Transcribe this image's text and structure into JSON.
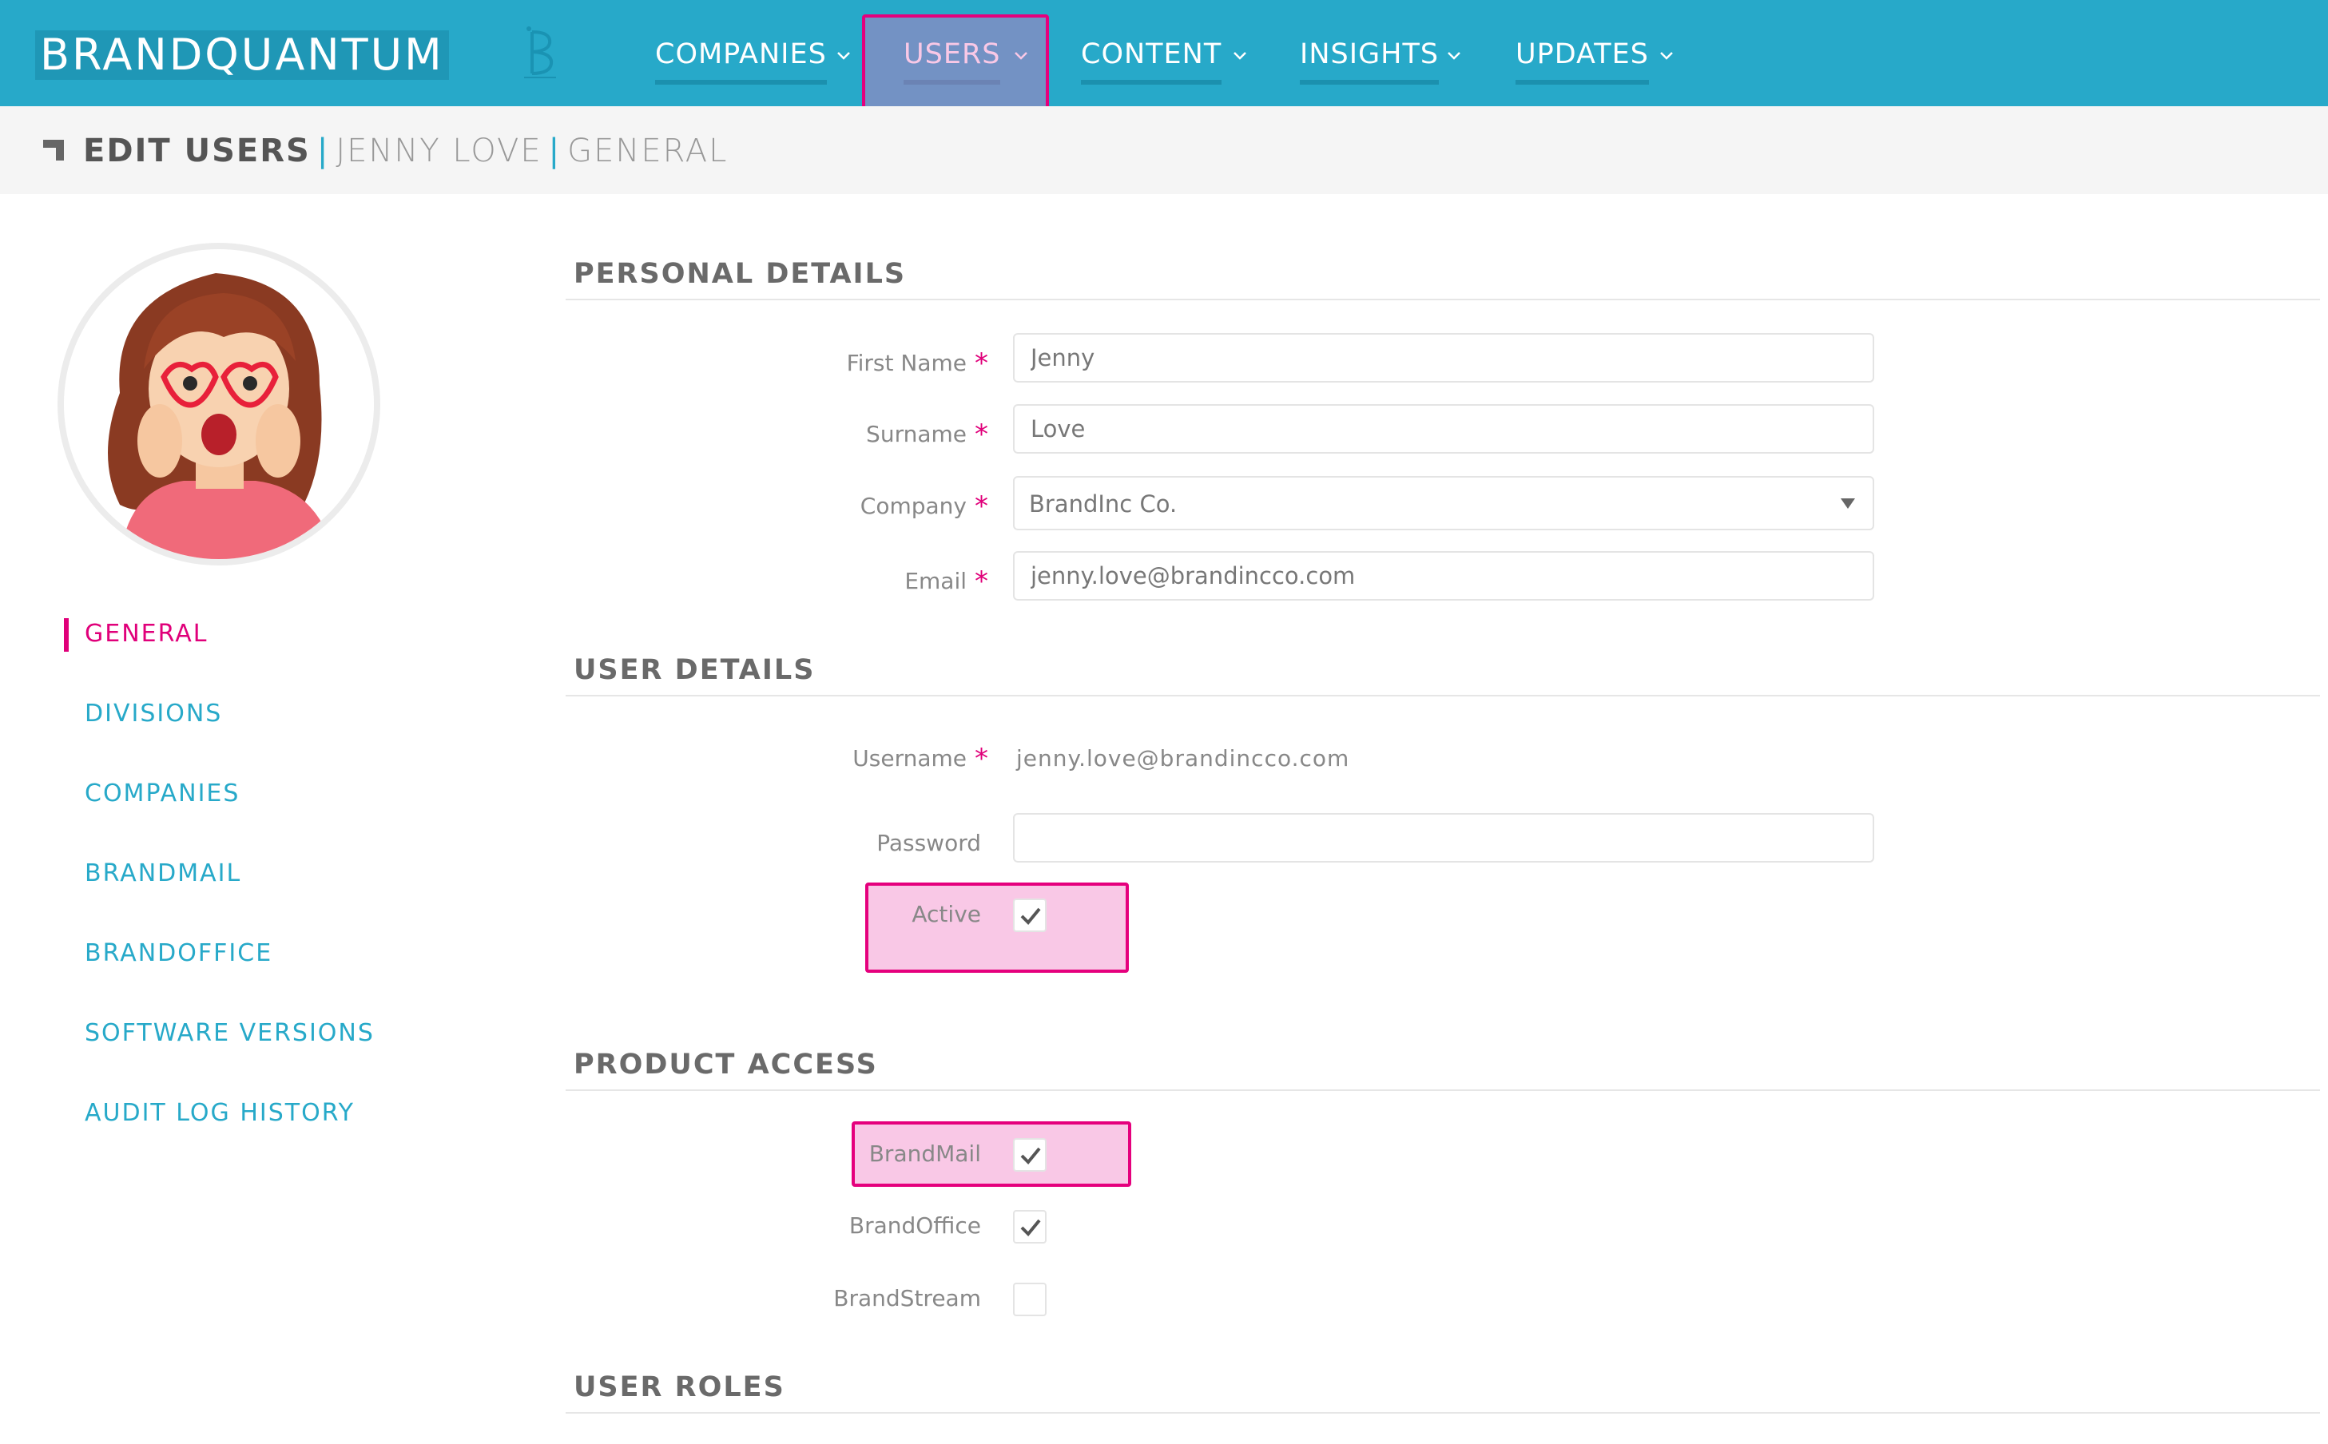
{
  "app": {
    "logo_text": "BRANDQUANTUM"
  },
  "nav": {
    "items": [
      {
        "label": "COMPANIES"
      },
      {
        "label": "USERS"
      },
      {
        "label": "CONTENT"
      },
      {
        "label": "INSIGHTS"
      },
      {
        "label": "UPDATES"
      }
    ],
    "active": "USERS"
  },
  "breadcrumb": {
    "section": "EDIT USERS",
    "user": "JENNY LOVE",
    "page": "GENERAL",
    "separator": "|"
  },
  "sidebar": {
    "items": [
      {
        "label": "GENERAL",
        "active": true
      },
      {
        "label": "DIVISIONS"
      },
      {
        "label": "COMPANIES"
      },
      {
        "label": "BRANDMAIL"
      },
      {
        "label": "BRANDOFFICE"
      },
      {
        "label": "SOFTWARE VERSIONS"
      },
      {
        "label": "AUDIT LOG HISTORY"
      }
    ]
  },
  "personal_details": {
    "title": "PERSONAL DETAILS",
    "first_name": {
      "label": "First Name",
      "value": "Jenny",
      "required": "*"
    },
    "surname": {
      "label": "Surname",
      "value": "Love",
      "required": "*"
    },
    "company": {
      "label": "Company",
      "value": "BrandInc Co.",
      "required": "*"
    },
    "email": {
      "label": "Email",
      "value": "jenny.love@brandincco.com",
      "required": "*"
    }
  },
  "user_details": {
    "title": "USER DETAILS",
    "username": {
      "label": "Username",
      "value": "jenny.love@brandincco.com",
      "required": "*"
    },
    "password": {
      "label": "Password",
      "value": ""
    },
    "active": {
      "label": "Active",
      "checked": true
    }
  },
  "product_access": {
    "title": "PRODUCT ACCESS",
    "products": [
      {
        "label": "BrandMail",
        "checked": true
      },
      {
        "label": "BrandOffice",
        "checked": true
      },
      {
        "label": "BrandStream",
        "checked": false
      }
    ]
  },
  "user_roles": {
    "title": "USER ROLES"
  },
  "colors": {
    "header": "#27a9c9",
    "accent": "#e0007a",
    "link": "#27a9c9",
    "highlight": "#e5007d"
  }
}
